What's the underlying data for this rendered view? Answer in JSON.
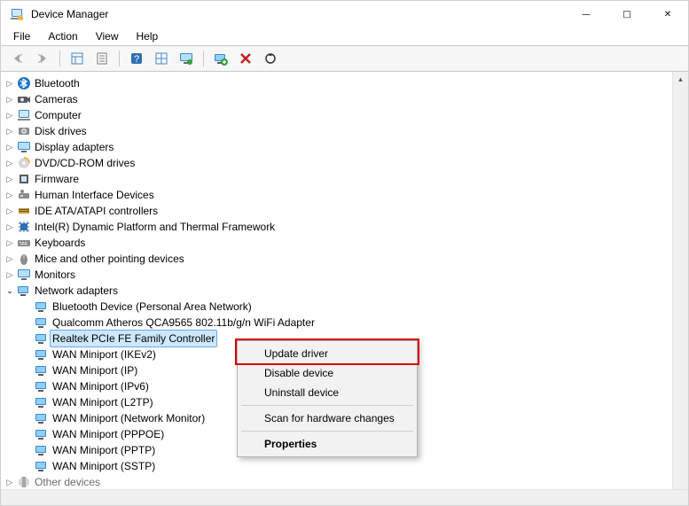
{
  "window": {
    "title": "Device Manager"
  },
  "menu": {
    "file": "File",
    "action": "Action",
    "view": "View",
    "help": "Help"
  },
  "toolbar": {
    "back": "Back",
    "forward": "Forward",
    "show_hide": "Show/Hide console tree",
    "properties": "Properties",
    "help": "Help",
    "table": "Show hidden devices",
    "monitor": "Scan for hardware changes",
    "install": "Add legacy hardware",
    "uninstall": "Uninstall device",
    "update": "Update driver"
  },
  "tree": {
    "top": [
      {
        "name": "Bluetooth",
        "icon": "bluetooth"
      },
      {
        "name": "Cameras",
        "icon": "camera"
      },
      {
        "name": "Computer",
        "icon": "computer"
      },
      {
        "name": "Disk drives",
        "icon": "disk"
      },
      {
        "name": "Display adapters",
        "icon": "display"
      },
      {
        "name": "DVD/CD-ROM drives",
        "icon": "cd"
      },
      {
        "name": "Firmware",
        "icon": "firmware"
      },
      {
        "name": "Human Interface Devices",
        "icon": "hid"
      },
      {
        "name": "IDE ATA/ATAPI controllers",
        "icon": "ide"
      },
      {
        "name": "Intel(R) Dynamic Platform and Thermal Framework",
        "icon": "chip"
      },
      {
        "name": "Keyboards",
        "icon": "keyboard"
      },
      {
        "name": "Mice and other pointing devices",
        "icon": "mouse"
      },
      {
        "name": "Monitors",
        "icon": "monitor"
      }
    ],
    "network_label": "Network adapters",
    "network_children": [
      {
        "name": "Bluetooth Device (Personal Area Network)"
      },
      {
        "name": "Qualcomm Atheros QCA9565 802.11b/g/n WiFi Adapter"
      },
      {
        "name": "Realtek PCIe FE Family Controller",
        "selected": true
      },
      {
        "name": "WAN Miniport (IKEv2)"
      },
      {
        "name": "WAN Miniport (IP)"
      },
      {
        "name": "WAN Miniport (IPv6)"
      },
      {
        "name": "WAN Miniport (L2TP)"
      },
      {
        "name": "WAN Miniport (Network Monitor)"
      },
      {
        "name": "WAN Miniport (PPPOE)"
      },
      {
        "name": "WAN Miniport (PPTP)"
      },
      {
        "name": "WAN Miniport (SSTP)"
      }
    ],
    "bottom": [
      {
        "name": "Other devices",
        "icon": "other"
      }
    ]
  },
  "context_menu": {
    "update": "Update driver",
    "disable": "Disable device",
    "uninstall": "Uninstall device",
    "scan": "Scan for hardware changes",
    "properties": "Properties"
  }
}
